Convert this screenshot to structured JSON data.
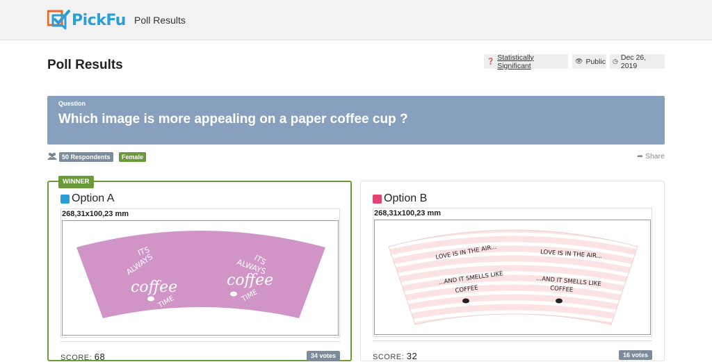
{
  "header": {
    "logo_text": "PickFu",
    "nav_link": "Poll Results"
  },
  "page": {
    "title": "Poll Results",
    "meta": {
      "significance": "Statistically Significant",
      "visibility": "Public",
      "date": "Dec 26, 2019"
    }
  },
  "question": {
    "label": "Question",
    "text": "Which image is more appealing on a paper coffee cup ?"
  },
  "audience": {
    "respondents": "50 Respondents",
    "segment": "Female",
    "share_label": "Share"
  },
  "options": [
    {
      "winner_label": "WINNER",
      "name": "Option A",
      "color": "#2a9fd6",
      "dimensions": "268,31x100,23 mm",
      "score_label": "SCORE:",
      "score": "68",
      "votes": "34 votes",
      "artwork": {
        "background": "#d194c6",
        "text_lines": [
          "ITS",
          "ALWAYS",
          "coffee",
          "TIME"
        ]
      }
    },
    {
      "name": "Option B",
      "color": "#e0446f",
      "dimensions": "268,31x100,23 mm",
      "score_label": "SCORE:",
      "score": "32",
      "votes": "16 votes",
      "artwork": {
        "background": "#fbe3e4",
        "text_lines": [
          "LOVE IS IN THE AIR...",
          "...AND IT SMELLS LIKE",
          "COFFEE"
        ]
      }
    }
  ],
  "colors": {
    "topbar": "#f2f2f2",
    "question_bg": "#87a0bd",
    "winner_green": "#6a9a3a",
    "badge_gray": "#7d8c9c",
    "logo_blue": "#2a9fd6",
    "logo_orange": "#e8652b"
  }
}
